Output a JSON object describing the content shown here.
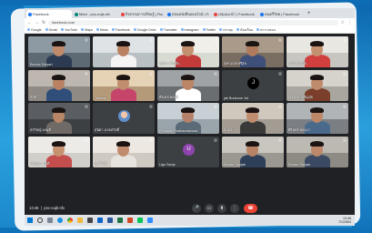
{
  "browser": {
    "tabs": [
      {
        "label": "Facebook",
        "color": "#1877f2",
        "active": true
      },
      {
        "label": "Meet - pnc-eujk-nfv",
        "color": "#00897b"
      },
      {
        "label": "กิจกรรมการเรียนรู้ | Flas",
        "color": "#e8453c"
      },
      {
        "label": "สอนหนังสือออนไลน์ | Fac",
        "color": "#1877f2"
      },
      {
        "label": "เล่มแนะนำ | Facebook",
        "color": "#e8453c"
      },
      {
        "label": "ดนตรีไทย | Facebook",
        "color": "#1877f2"
      }
    ],
    "new_tab": "+",
    "url": "facebook.com",
    "bookmarks": [
      "Google",
      "Gmail",
      "YouTube",
      "Maps",
      "News",
      "Facebook",
      "Google Drive",
      "Translate",
      "Instagram",
      "Twitter",
      "ประชุม",
      "ห้องเรียน",
      "ตารางสอน"
    ]
  },
  "meeting": {
    "participants": [
      {
        "name": "Banlue Saiyart"
      },
      {
        "name": ""
      },
      {
        "name": "ชุติมา คำกลิ่น"
      },
      {
        "name": "จุฑามาศ ศรีสุข"
      },
      {
        "name": "ภาวิณี สมใจ"
      },
      {
        "name": "กิตติ"
      },
      {
        "name": "Tamkao"
      },
      {
        "name": "ธีรเดช ทองดี"
      },
      {
        "name": "jak Bunlome 1st"
      },
      {
        "name": "ณัฐพงษ์ เจริญสุข"
      },
      {
        "name": "สรวิชญ์ พรมดี"
      },
      {
        "name": "สุนิตา นาคสวัสดิ์"
      },
      {
        "name": "Phurinat Phathanasiriwat"
      },
      {
        "name": "อัมพร"
      },
      {
        "name": "ศิรินทร์ ทองมา"
      },
      {
        "name": "ปริญญา สุขดี"
      },
      {
        "name": "ระวี ใจดี"
      },
      {
        "name": "Ugo Sanjo"
      },
      {
        "name": "Baram Sanjab"
      },
      {
        "name": "Baram Sanjab"
      }
    ],
    "avatar_letters": [
      "",
      "",
      "",
      "",
      "",
      "",
      "",
      "",
      "J",
      "",
      "",
      "",
      "",
      "",
      "",
      "",
      "",
      "U",
      "",
      ""
    ],
    "time": "13:46",
    "code": "pnc-eujk-nfv",
    "controls": {
      "mic": "🎤",
      "camera": "▭",
      "present": "⬆",
      "more": "⋮",
      "end": "☎"
    }
  },
  "taskbar": {
    "clock_time": "13:46",
    "clock_date": "7/1/2564"
  },
  "colors": {
    "tile_bg": "#3c4043",
    "end_call": "#ea4335",
    "frame": "#eef3f8"
  }
}
